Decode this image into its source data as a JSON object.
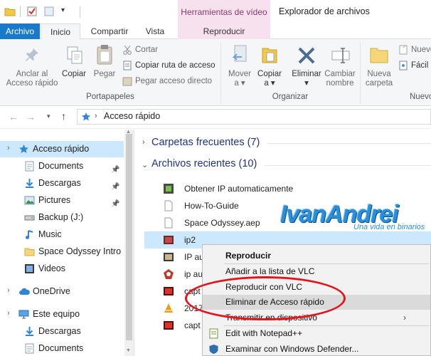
{
  "window": {
    "title": "Explorador de archivos",
    "context_tab_group": "Herramientas de vídeo"
  },
  "tabs": {
    "archivo": "Archivo",
    "inicio": "Inicio",
    "compartir": "Compartir",
    "vista": "Vista",
    "reproducir": "Reproducir"
  },
  "ribbon": {
    "portapapeles": {
      "label": "Portapapeles",
      "anclar": [
        "Anclar al",
        "Acceso rápido"
      ],
      "copiar": "Copiar",
      "pegar": "Pegar",
      "cortar": "Cortar",
      "copiar_ruta": "Copiar ruta de acceso",
      "pegar_acceso": "Pegar acceso directo"
    },
    "organizar": {
      "label": "Organizar",
      "mover": [
        "Mover",
        "a ▾"
      ],
      "copiar": [
        "Copiar",
        "a ▾"
      ],
      "eliminar": [
        "Eliminar",
        "▾"
      ],
      "cambiar": [
        "Cambiar",
        "nombre"
      ]
    },
    "nuevo": {
      "label": "Nuevo",
      "nueva_carpeta": [
        "Nueva",
        "carpeta"
      ],
      "nuevo_elemento": "Nuevo",
      "facil_acceso": "Fácil a"
    }
  },
  "address": {
    "path": "Acceso rápido"
  },
  "nav": [
    {
      "label": "Acceso rápido",
      "icon": "star-icon",
      "pinned": false,
      "selected": true
    },
    {
      "label": "Documents",
      "icon": "document-icon",
      "pinned": true
    },
    {
      "label": "Descargas",
      "icon": "download-icon",
      "pinned": true
    },
    {
      "label": "Pictures",
      "icon": "pictures-icon",
      "pinned": true
    },
    {
      "label": "Backup (J:)",
      "icon": "drive-icon",
      "pinned": false
    },
    {
      "label": "Music",
      "icon": "music-icon",
      "pinned": false
    },
    {
      "label": "Space Odyssey Intro",
      "icon": "folder-icon",
      "pinned": false
    },
    {
      "label": "Videos",
      "icon": "video-icon",
      "pinned": false
    },
    {
      "label": "OneDrive",
      "icon": "cloud-icon",
      "pinned": false
    },
    {
      "label": "Este equipo",
      "icon": "computer-icon",
      "pinned": false
    },
    {
      "label": "Descargas",
      "icon": "download-icon",
      "pinned": false
    },
    {
      "label": "Documents",
      "icon": "document-icon",
      "pinned": false
    }
  ],
  "content": {
    "frequent_folders": "Carpetas frecuentes (7)",
    "recent_files": "Archivos recientes (10)",
    "files": [
      "Obtener IP automaticamente",
      "How-To-Guide",
      "Space Odyssey.aep",
      "ip2",
      "IP au",
      "ip au",
      "capt",
      "2017",
      "capt"
    ]
  },
  "watermark": {
    "title": "IvanAndrei",
    "subtitle": "Una vida en binarios"
  },
  "context_menu": [
    {
      "label": "Reproducir",
      "bold": true
    },
    {
      "label": "Añadir a la lista de VLC"
    },
    {
      "label": "Reproducir con VLC"
    },
    {
      "label": "Eliminar de Acceso rápido",
      "highlighted": true
    },
    {
      "label": "Transmitir en dispositivo",
      "submenu": true
    },
    {
      "label": "Edit with Notepad++"
    },
    {
      "label": "Examinar con Windows Defender..."
    }
  ],
  "colors": {
    "accent": "#1979ca",
    "context_tab": "#f8e1ef",
    "selection": "#cce8ff",
    "highlight_ring": "#e3141c",
    "section_heading": "#1e3287"
  }
}
